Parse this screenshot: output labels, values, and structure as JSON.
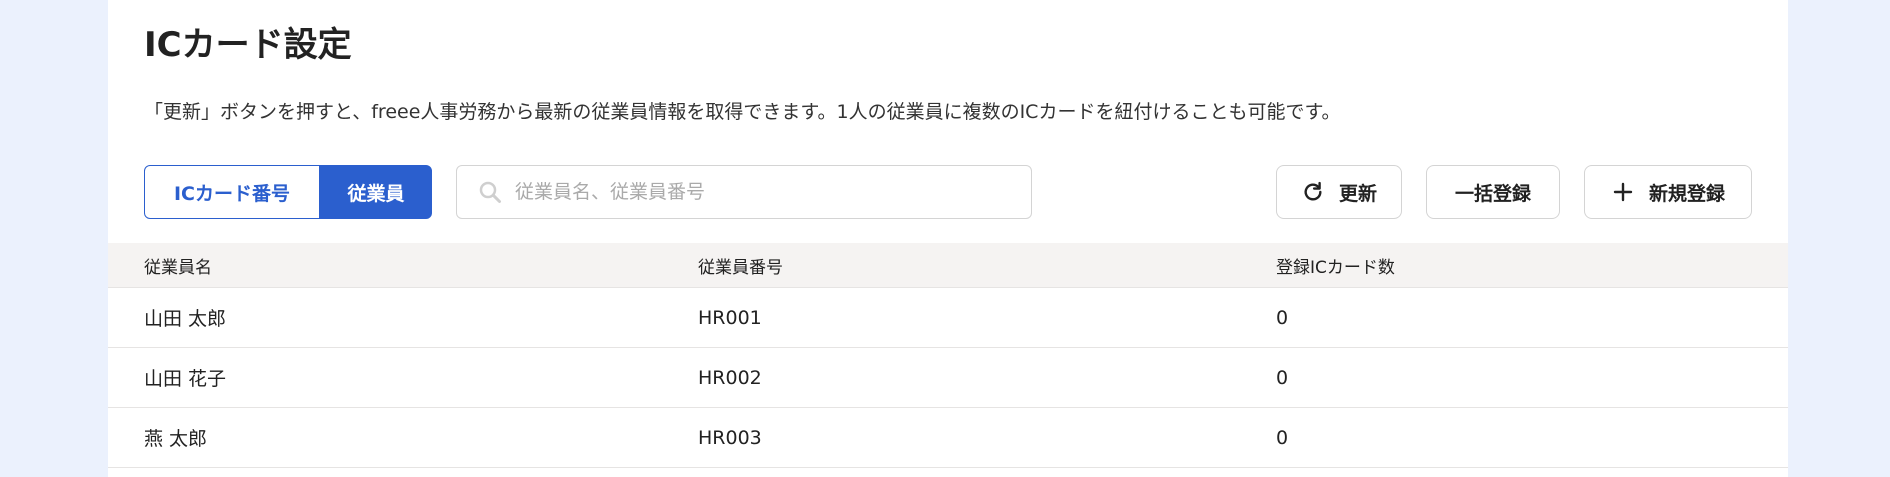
{
  "page": {
    "title": "ICカード設定",
    "description": "「更新」ボタンを押すと、freee人事労務から最新の従業員情報を取得できます。1人の従業員に複数のICカードを紐付けることも可能です。"
  },
  "toggle": {
    "options": [
      {
        "label": "ICカード番号",
        "selected": false
      },
      {
        "label": "従業員",
        "selected": true
      }
    ]
  },
  "search": {
    "placeholder": "従業員名、従業員番号",
    "value": "",
    "icon": "search-icon"
  },
  "actions": {
    "refresh": {
      "label": "更新",
      "icon": "refresh-icon"
    },
    "bulk": {
      "label": "一括登録"
    },
    "new": {
      "label": "新規登録",
      "icon": "plus-icon"
    }
  },
  "table": {
    "columns": [
      "従業員名",
      "従業員番号",
      "登録ICカード数"
    ],
    "rows": [
      {
        "name": "山田 太郎",
        "number": "HR001",
        "cards": "0"
      },
      {
        "name": "山田 花子",
        "number": "HR002",
        "cards": "0"
      },
      {
        "name": "燕 太郎",
        "number": "HR003",
        "cards": "0"
      }
    ]
  },
  "colors": {
    "page_background": "#ebf1fd",
    "accent": "#2b5fce",
    "table_header_background": "#f5f3f2",
    "border": "#d4d4d4"
  }
}
